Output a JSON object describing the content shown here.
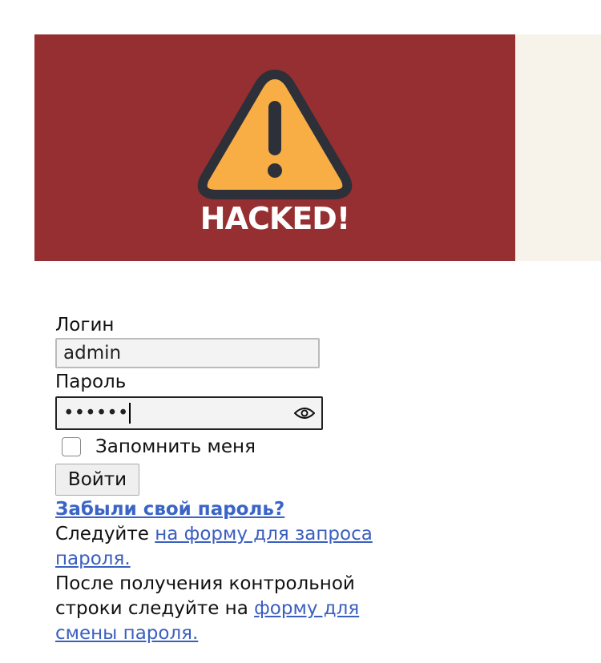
{
  "banner": {
    "text": "HACKED!",
    "bg_color": "#962f31",
    "icon": "warning-triangle-icon"
  },
  "form": {
    "login_label": "Логин",
    "login_value": "admin",
    "password_label": "Пароль",
    "password_value": "••••••",
    "remember_label": "Запомнить меня",
    "remember_checked": false,
    "submit_label": "Войти"
  },
  "help": {
    "forgot_link": "Забыли свой пароль?",
    "follow_text": "Следуйте ",
    "request_link": "на форму для запроса пароля.",
    "after_text": "После получения контрольной строки следуйте на ",
    "change_link": "форму для смены пароля."
  }
}
